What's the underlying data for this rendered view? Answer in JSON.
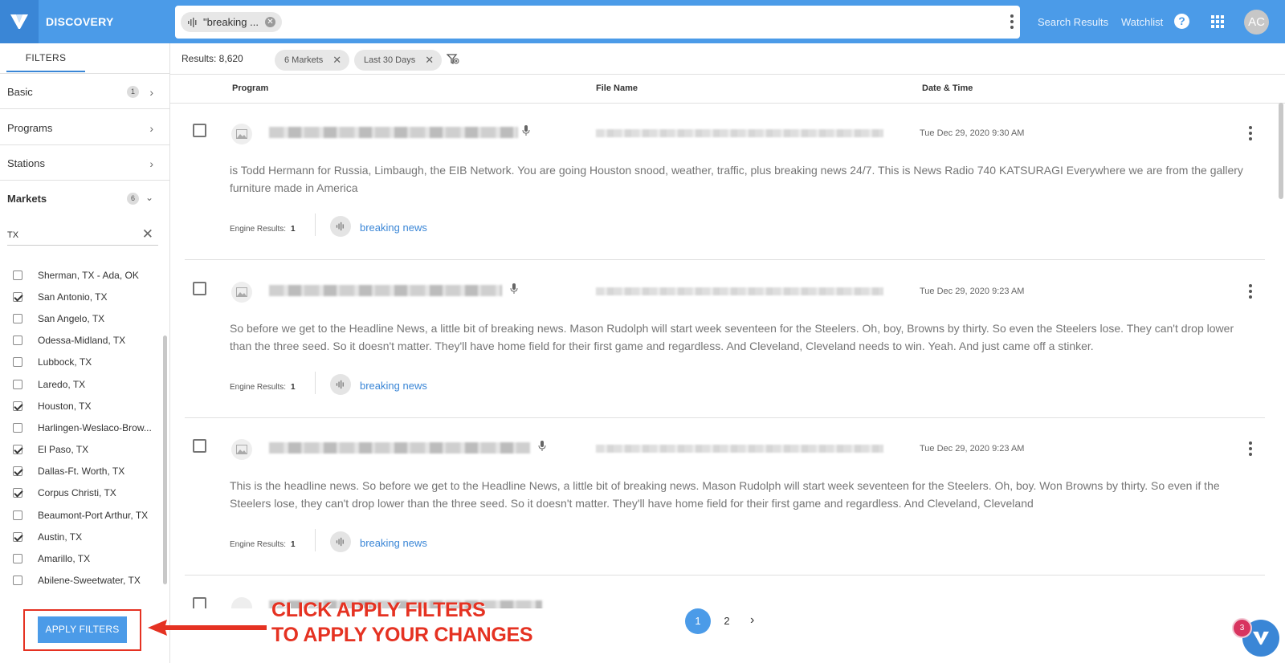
{
  "app": {
    "title": "DISCOVERY"
  },
  "search": {
    "chip_label": "\"breaking ...",
    "menu_icon": "kebab-icon"
  },
  "header": {
    "links": [
      "Search Results",
      "Watchlist"
    ],
    "help": "?",
    "avatar": "AC"
  },
  "sidebar": {
    "tab": "FILTERS",
    "sections": [
      {
        "label": "Basic",
        "badge": "1"
      },
      {
        "label": "Programs",
        "badge": ""
      },
      {
        "label": "Stations",
        "badge": ""
      },
      {
        "label": "Markets",
        "badge": "6"
      }
    ],
    "market_search": {
      "value": "TX",
      "placeholder": ""
    },
    "markets": [
      {
        "label": "Sherman, TX - Ada, OK",
        "checked": false
      },
      {
        "label": "San Antonio, TX",
        "checked": true
      },
      {
        "label": "San Angelo, TX",
        "checked": false
      },
      {
        "label": "Odessa-Midland, TX",
        "checked": false
      },
      {
        "label": "Lubbock, TX",
        "checked": false
      },
      {
        "label": "Laredo, TX",
        "checked": false
      },
      {
        "label": "Houston, TX",
        "checked": true
      },
      {
        "label": "Harlingen-Weslaco-Brow...",
        "checked": false
      },
      {
        "label": "El Paso, TX",
        "checked": true
      },
      {
        "label": "Dallas-Ft. Worth, TX",
        "checked": true
      },
      {
        "label": "Corpus Christi, TX",
        "checked": true
      },
      {
        "label": "Beaumont-Port Arthur, TX",
        "checked": false
      },
      {
        "label": "Austin, TX",
        "checked": true
      },
      {
        "label": "Amarillo, TX",
        "checked": false
      },
      {
        "label": "Abilene-Sweetwater, TX",
        "checked": false
      }
    ],
    "apply_label": "APPLY FILTERS"
  },
  "results": {
    "count_label": "Results: 8,620",
    "filter_chips": [
      "6 Markets",
      "Last 30 Days"
    ],
    "columns": [
      "Program",
      "File Name",
      "Date & Time"
    ],
    "rows": [
      {
        "datetime": "Tue Dec 29, 2020 9:30 AM",
        "snippet": "is Todd Hermann for Russia, Limbaugh, the EIB Network. You are going Houston snood, weather, traffic, plus breaking news 24/7. This is News Radio 740 KATSURAGI Everywhere we are from the gallery furniture made in America",
        "engine_label": "Engine Results:",
        "engine_count": "1",
        "term": "breaking news"
      },
      {
        "datetime": "Tue Dec 29, 2020 9:23 AM",
        "snippet": "So before we get to the Headline News, a little bit of breaking news. Mason Rudolph will start week seventeen for the Steelers. Oh, boy, Browns by thirty. So even the Steelers lose. They can't drop lower than the three seed. So it doesn't matter. They'll have home field for their first game and regardless. And Cleveland, Cleveland needs to win. Yeah. And just came off a stinker.",
        "engine_label": "Engine Results:",
        "engine_count": "1",
        "term": "breaking news"
      },
      {
        "datetime": "Tue Dec 29, 2020 9:23 AM",
        "snippet": "This is the headline news. So before we get to the Headline News, a little bit of breaking news. Mason Rudolph will start week seventeen for the Steelers. Oh, boy. Won Browns by thirty. So even if the Steelers lose, they can't drop lower than the three seed. So it doesn't matter. They'll have home field for their first game and regardless. And Cleveland, Cleveland",
        "engine_label": "Engine Results:",
        "engine_count": "1",
        "term": "breaking news"
      }
    ]
  },
  "pagination": {
    "pages": [
      "1",
      "2"
    ],
    "current": "1"
  },
  "annotation": {
    "line1": "CLICK APPLY FILTERS",
    "line2": "TO APPLY YOUR CHANGES"
  },
  "chat": {
    "badge": "3"
  },
  "colors": {
    "brand": "#4b9be8",
    "brand_dark": "#3a86d6",
    "annotation": "#e53222",
    "link": "#3a86d6"
  }
}
